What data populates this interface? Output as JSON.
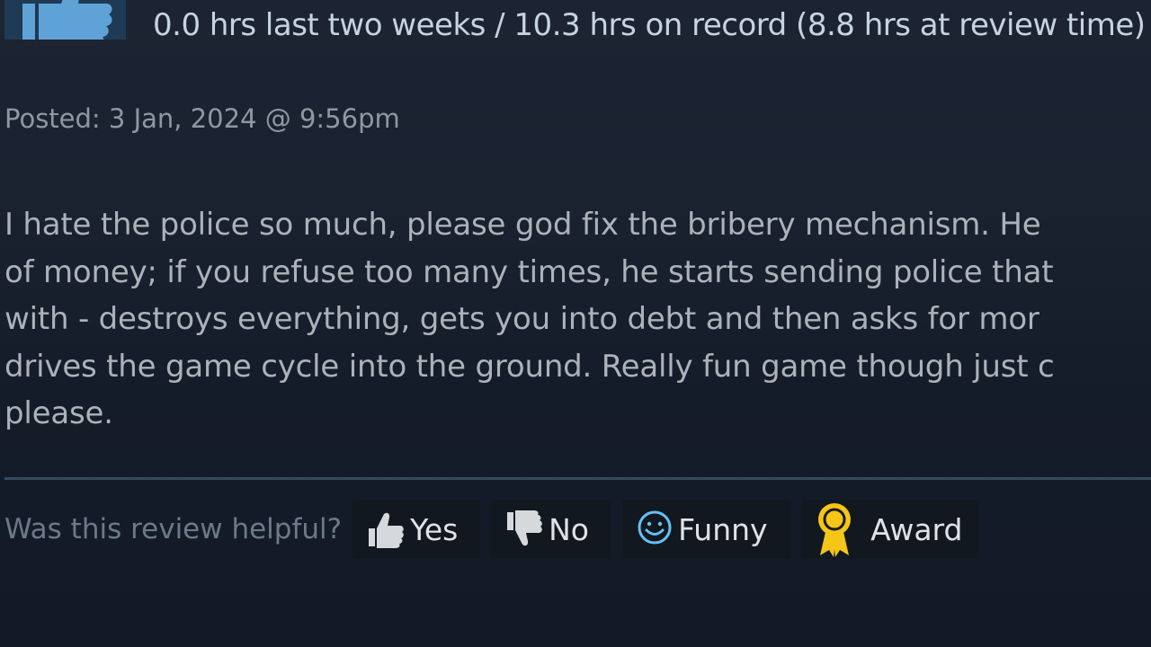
{
  "review": {
    "playtime": "0.0 hrs last two weeks / 10.3 hrs on record (8.8 hrs at review time)",
    "posted": "Posted: 3 Jan, 2024 @ 9:56pm",
    "body_lines": [
      "I hate the police so much, please god fix the bribery mechanism. He",
      "of money; if you refuse too many times, he starts sending police that",
      "with - destroys everything, gets you into debt and then asks for mor",
      "drives the game cycle into the ground. Really fun game though just c",
      "please."
    ]
  },
  "helpful": {
    "question": "Was this review helpful?",
    "yes_label": "Yes",
    "no_label": "No",
    "funny_label": "Funny",
    "award_label": "Award"
  },
  "icons": {
    "recommended": "thumbs-up-icon",
    "yes": "thumbs-up-icon",
    "no": "thumbs-down-icon",
    "funny": "smiley-icon",
    "award": "award-ribbon-icon"
  },
  "colors": {
    "background": "#1b2331",
    "text_primary": "#c6d4df",
    "text_muted": "#8f98a0",
    "divider": "#364a5c",
    "button_bg": "#111820",
    "funny_accent": "#66c0f4",
    "award_accent": "#f5c518"
  }
}
